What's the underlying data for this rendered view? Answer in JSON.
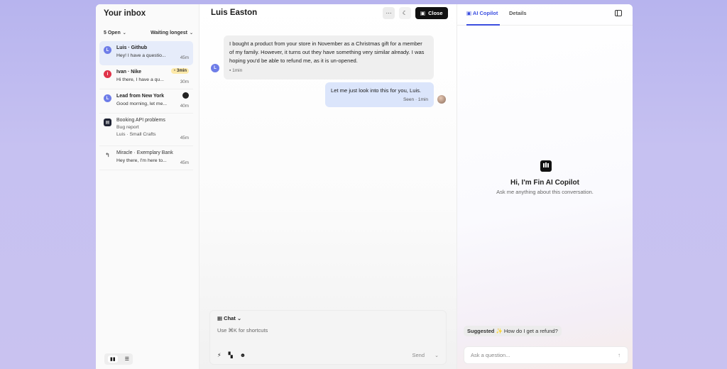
{
  "inbox": {
    "title": "Your inbox",
    "filter_open": "5 Open",
    "filter_sort": "Waiting longest",
    "conversations": [
      {
        "avatar": "L",
        "avatar_color": "#6e7de8",
        "name": "Luis · Github",
        "snippet": "Hey! I have a questio...",
        "time": "45m"
      },
      {
        "avatar": "I",
        "avatar_color": "#e0344a",
        "name": "Ivan · Nike",
        "snippet": "Hi there, I have a qu...",
        "time": "30m",
        "badge": "3min"
      },
      {
        "avatar": "L",
        "avatar_color": "#6e7de8",
        "name": "Lead from New York",
        "snippet": "Good morning, let me...",
        "time": "40m"
      },
      {
        "name": "Booking API problems",
        "snippet": "Bug report",
        "sub": "Luis · Small Crafts",
        "time": "45m"
      },
      {
        "name": "Miracle · Exemplary Bank",
        "snippet": "Hey there, I'm here to...",
        "time": "45m"
      }
    ]
  },
  "conversation": {
    "title": "Luis Easton",
    "close_label": "Close",
    "messages": [
      {
        "from": "customer",
        "avatar": "L",
        "text": "I bought a product from your store in November as a Christmas gift for a member of my family. However, it turns out they have something very similar already. I was hoping you'd be able to refund me, as it is un-opened.",
        "meta": "1min"
      },
      {
        "from": "agent",
        "text": "Let me just look into this for you, Luis.",
        "meta": "Seen · 1min"
      }
    ],
    "composer": {
      "mode": "Chat",
      "hint": "Use ⌘K for shortcuts",
      "send_label": "Send"
    }
  },
  "copilot": {
    "tabs": [
      "AI Copilot",
      "Details"
    ],
    "greeting": "Hi, I'm Fin AI Copilot",
    "subtitle": "Ask me anything about this conversation.",
    "suggested_label": "Suggested",
    "suggested_question": "How do I get a refund?",
    "ask_placeholder": "Ask a question..."
  }
}
